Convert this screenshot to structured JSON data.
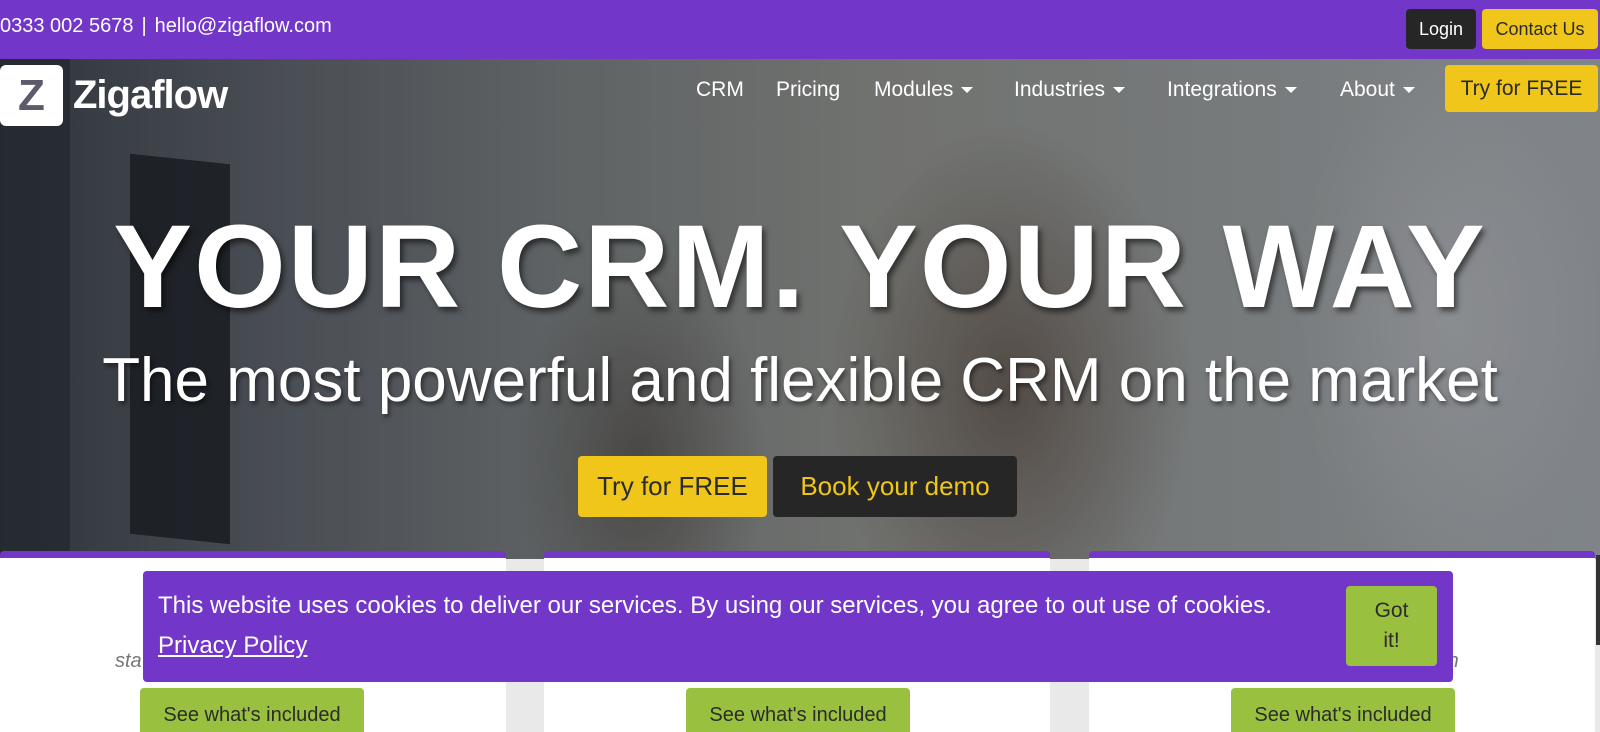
{
  "topbar": {
    "phone": "0333 002 5678",
    "separator": "|",
    "email": "hello@zigaflow.com",
    "login_label": "Login",
    "contact_label": "Contact Us"
  },
  "brand": {
    "logo_letter": "Z",
    "name": "Zigaflow"
  },
  "nav": {
    "items": [
      {
        "label": "CRM"
      },
      {
        "label": "Pricing"
      },
      {
        "label": "Modules"
      },
      {
        "label": "Industries"
      },
      {
        "label": "Integrations"
      },
      {
        "label": "About"
      }
    ],
    "cta_label": "Try for FREE"
  },
  "hero": {
    "title": "YOUR CRM. YOUR WAY",
    "subtitle": "The most powerful and flexible CRM on the market",
    "primary_cta": "Try for FREE",
    "secondary_cta": "Book your demo"
  },
  "cards": [
    {
      "partial_text": "sta",
      "button_label": "See what's included"
    },
    {
      "partial_text": "",
      "button_label": "See what's included"
    },
    {
      "partial_text": "nth",
      "button_label": "See what's included"
    }
  ],
  "cookie": {
    "text": "This website uses cookies to deliver our services. By using our services, you agree to out use of cookies.",
    "link_label": "Privacy Policy",
    "button_label": "Got it!"
  },
  "colors": {
    "brand_purple": "#7236c9",
    "accent_yellow": "#efc619",
    "accent_green": "#99c13f",
    "dark": "#262626"
  }
}
